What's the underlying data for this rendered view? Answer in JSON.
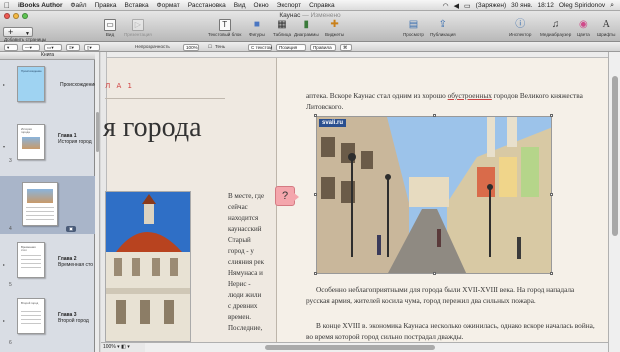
{
  "menubar": {
    "items": [
      "iBooks Author",
      "Файл",
      "Правка",
      "Вставка",
      "Формат",
      "Расстановка",
      "Вид",
      "Окно",
      "Экспорт",
      "Справка"
    ],
    "right": {
      "status": "(Заряжен)",
      "date": "30 янв.",
      "time": "18:12",
      "user": "Oleg Spiridonov"
    }
  },
  "window": {
    "title": "Каунас",
    "subtitle": "Изменено"
  },
  "toolbar": {
    "add_page_label": "Добавить страницы",
    "left": [
      {
        "label": "Вид",
        "icon": "▭"
      },
      {
        "label": "Презентация",
        "icon": "▷",
        "disabled": true
      }
    ],
    "insert": [
      {
        "label": "Текстовый блок",
        "icon": "T"
      },
      {
        "label": "Фигуры",
        "icon": "■"
      },
      {
        "label": "Таблица",
        "icon": "▦"
      },
      {
        "label": "Диаграммы",
        "icon": "▮"
      },
      {
        "label": "Виджеты",
        "icon": "✚"
      }
    ],
    "right": [
      {
        "label": "Просмотр",
        "icon": "▤"
      },
      {
        "label": "Публикация",
        "icon": "⇪"
      },
      {
        "label": "Инспектор",
        "icon": "ⓘ"
      },
      {
        "label": "Медиабраузер",
        "icon": "♫"
      },
      {
        "label": "Цвета",
        "icon": "◉"
      },
      {
        "label": "Шрифты",
        "icon": "A"
      }
    ]
  },
  "formatbar": {
    "opacity_label": "Непрозрачность",
    "opacity_value": "100%",
    "shadow_label": "Тень",
    "text_btn": "С текстом",
    "perimeter_btn": "Позиция",
    "rules_btn": "Правила"
  },
  "sidebar": {
    "header": "Книга",
    "rows": [
      {
        "num": "",
        "title": "",
        "label": "Происхождение",
        "thumb_title": "Происхождение"
      },
      {
        "num": "3",
        "title": "Глава 1",
        "label": "История город",
        "thumb_title": "История города"
      },
      {
        "num": "4",
        "title": "",
        "label": "",
        "thumb_title": ""
      },
      {
        "num": "5",
        "title": "Глава 2",
        "label": "Временная сто",
        "thumb_title": "Временная стол"
      },
      {
        "num": "6",
        "title": "Глава 3",
        "label": "Второй город",
        "thumb_title": "Второй город"
      }
    ]
  },
  "page": {
    "chapter_marker": "Л А 1",
    "heading": "я города",
    "left_column": [
      "В месте, где",
      "сейчас",
      "находится",
      "каунасский",
      "Старый",
      "город - у",
      "слияния рек",
      "Нямунаса и",
      "Нерис -",
      "люди жили",
      "с древних",
      "времен.",
      "Последние,"
    ],
    "para1": {
      "before": "аптека. Вскоре Каунас стал одним из хорошо ",
      "underlined": "обустроенных",
      "after": " городов Великого княжества Литовского."
    },
    "watermark": "svali.ru",
    "para2": "Особенно неблагоприятными для города были XVII-XVIII века. На город нападала русская армия, жителей косила чума, город пережил два сильных пожара.",
    "para3": "В конце XVIII в. экономика Каунаса несколько ожинилась, однако вскоре началась война, во время которой город сильно пострадал дважды.",
    "note": "?"
  },
  "statusbar": {
    "zoom": "100%"
  }
}
